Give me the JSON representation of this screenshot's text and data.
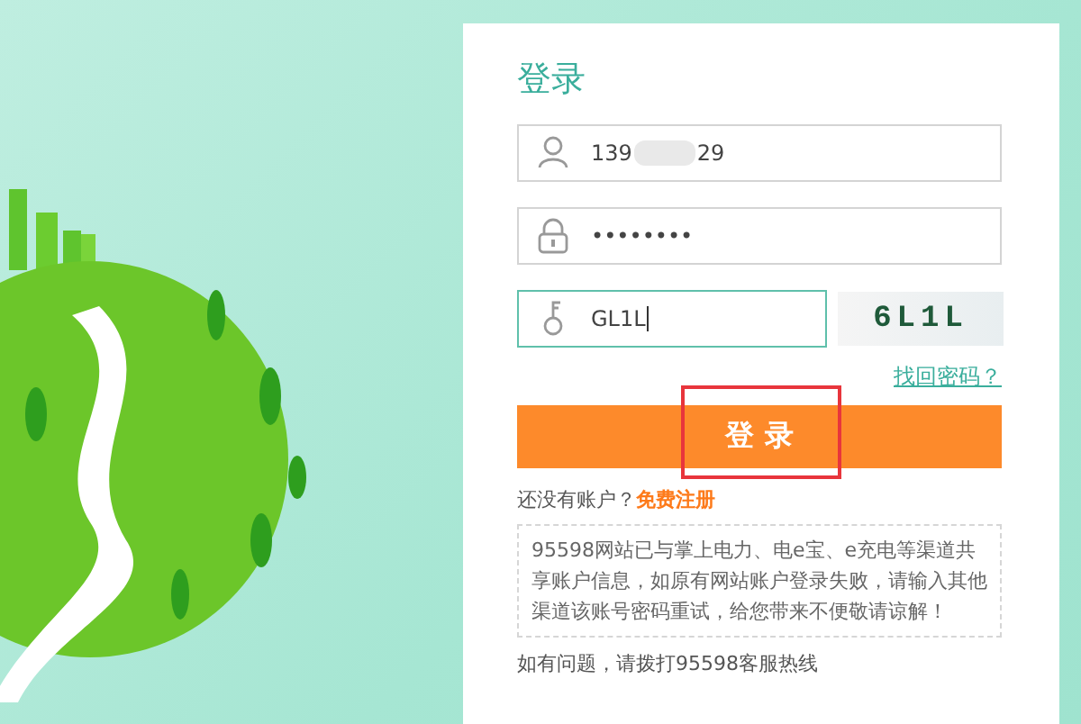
{
  "login_card": {
    "title": "登录",
    "fields": [
      {
        "kind": "user",
        "value_prefix": "139",
        "redacted": true,
        "value_suffix": "29",
        "focused": false
      },
      {
        "kind": "password",
        "value_prefix": "••••••••",
        "redacted": false,
        "focused": false
      },
      {
        "kind": "captcha",
        "value_prefix": "GL1L",
        "redacted": false,
        "focused": true,
        "captcha_text": "6L1L"
      }
    ],
    "forgot_link": "找回密码？",
    "login_button": {
      "label": "登 录",
      "highlighted": true
    },
    "register_prompt": "还没有账户？",
    "register_link": "免费注册",
    "notice": "95598网站已与掌上电力、电e宝、e充电等渠道共享账户信息，如原有网站账户登录失败，请输入其他渠道该账号密码重试，给您带来不便敬请谅解！",
    "help_text": "如有问题，请拨打95598客服热线"
  }
}
